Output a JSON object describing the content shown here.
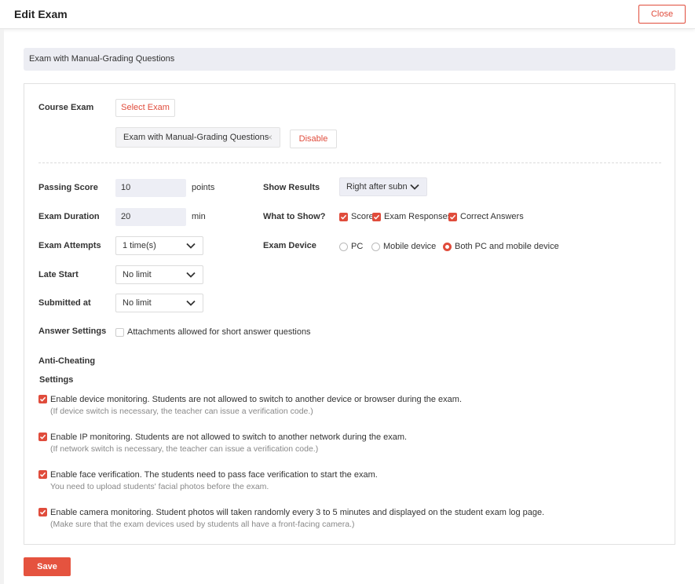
{
  "header": {
    "title": "Edit Exam",
    "close_label": "Close"
  },
  "exam_bar": {
    "text": "Exam with Manual-Grading Questions"
  },
  "course_exam": {
    "label": "Course Exam",
    "select_button": "Select Exam",
    "selected_exam": "Exam with Manual-Grading Questions",
    "tag_close": "×",
    "disable_button": "Disable"
  },
  "passing_score": {
    "label": "Passing Score",
    "value": "10",
    "unit": "points"
  },
  "exam_duration": {
    "label": "Exam Duration",
    "value": "20",
    "unit": "min"
  },
  "exam_attempts": {
    "label": "Exam Attempts",
    "value": "1 time(s)"
  },
  "late_start": {
    "label": "Late Start",
    "value": "No limit"
  },
  "submitted_at": {
    "label": "Submitted at",
    "value": "No limit"
  },
  "show_results": {
    "label": "Show Results",
    "value": "Right after subn"
  },
  "what_to_show": {
    "label": "What to Show?",
    "options": [
      {
        "label": "Score",
        "checked": true
      },
      {
        "label": "Exam Responses",
        "checked": true
      },
      {
        "label": "Correct Answers",
        "checked": true
      }
    ]
  },
  "exam_device": {
    "label": "Exam Device",
    "options": [
      {
        "label": "PC",
        "selected": false
      },
      {
        "label": "Mobile device",
        "selected": false
      },
      {
        "label": "Both PC and mobile device",
        "selected": true
      }
    ]
  },
  "answer_settings": {
    "label": "Answer Settings",
    "option": "Attachments allowed for short answer questions",
    "checked": false
  },
  "anti_cheating": {
    "label_line1": "Anti-Cheating",
    "label_line2": "Settings",
    "items": [
      {
        "text": "Enable device monitoring. Students are not allowed to switch to another device or browser during the exam.",
        "note": "(If device switch is necessary, the teacher can issue a verification code.)",
        "checked": true
      },
      {
        "text": "Enable IP monitoring. Students are not allowed to switch to another network during the exam.",
        "note": "(If network switch is necessary, the teacher can issue a verification code.)",
        "checked": true
      },
      {
        "text": "Enable face verification. The students need to pass face verification to start the exam.",
        "note": "You need to upload students' facial photos before the exam.",
        "checked": true
      },
      {
        "text": "Enable camera monitoring. Student photos will taken randomly every 3 to 5 minutes and displayed on the student exam log page.",
        "note": "(Make sure that the exam devices used by students all have a front-facing camera.)",
        "checked": true
      }
    ]
  },
  "footer": {
    "save_label": "Save"
  },
  "colors": {
    "accent": "#e04c3c",
    "input_bg": "#edeef5",
    "bar_bg": "#ecedf3"
  }
}
